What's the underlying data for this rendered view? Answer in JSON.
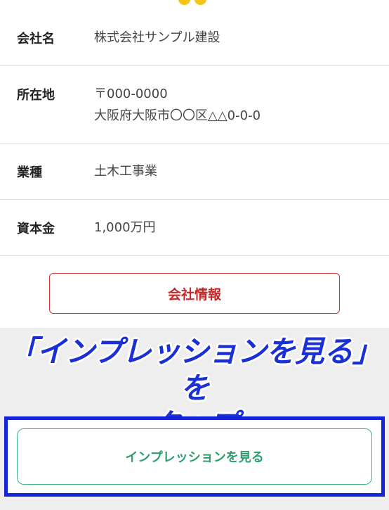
{
  "company": {
    "rows": [
      {
        "label": "会社名",
        "value": "株式会社サンプル建設"
      },
      {
        "label": "所在地",
        "value_line1": "〒000-0000",
        "value_line2": "大阪府大阪市〇〇区△△0-0-0"
      },
      {
        "label": "業種",
        "value": "土木工事業"
      },
      {
        "label": "資本金",
        "value": "1,000万円"
      }
    ]
  },
  "buttons": {
    "company_info": "会社情報",
    "impression": "インプレッションを見る"
  },
  "instruction": {
    "line1": "「インプレッションを見る」を",
    "line2": "タップ"
  },
  "colors": {
    "company_info_border": "#d03030",
    "impression_border": "#3fb486",
    "instruction_text": "#1a2fd6",
    "highlight_border": "#1325d6"
  }
}
